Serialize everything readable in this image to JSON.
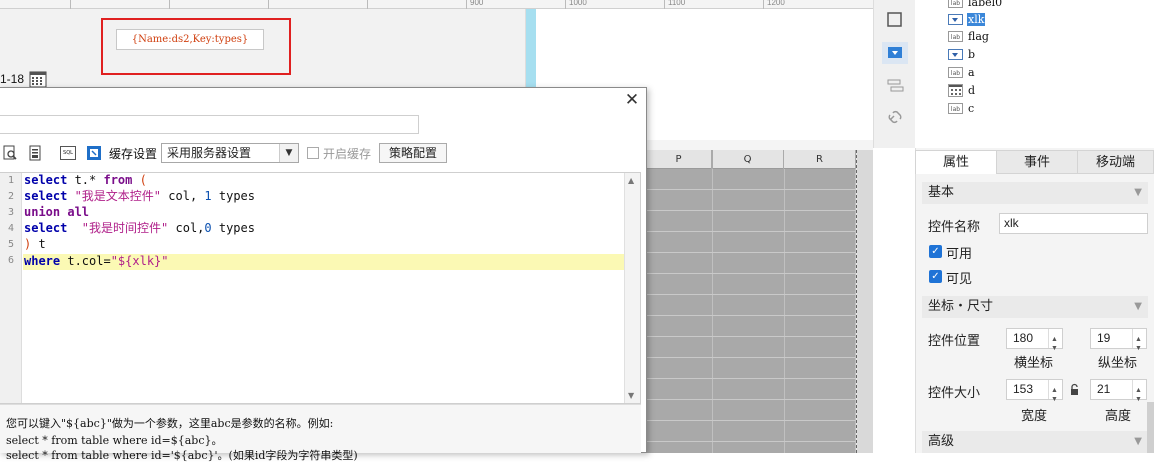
{
  "ruler": {
    "marks": [
      "900",
      "1000",
      "1100",
      "1200"
    ]
  },
  "canvas": {
    "param_label": "{Name:ds2,Key:types}",
    "date_text": "1-18"
  },
  "sheet": {
    "columns": [
      "P",
      "Q",
      "R"
    ]
  },
  "tree": {
    "items": [
      {
        "label": "label0",
        "icon": "label-widget-icon",
        "icon_text": "lab"
      },
      {
        "label": "xlk",
        "icon": "dropdown-widget-icon",
        "selected": true
      },
      {
        "label": "flag",
        "icon": "label-widget-icon",
        "icon_text": "lab"
      },
      {
        "label": "b",
        "icon": "dropdown-widget-icon"
      },
      {
        "label": "a",
        "icon": "label-widget-icon",
        "icon_text": "lab"
      },
      {
        "label": "d",
        "icon": "date-widget-icon"
      },
      {
        "label": "c",
        "icon": "label-widget-icon",
        "icon_text": "lab"
      }
    ]
  },
  "props": {
    "tabs": [
      "属性",
      "事件",
      "移动端"
    ],
    "section_basic": "基本",
    "name_label": "控件名称",
    "name_value": "xlk",
    "enabled_label": "可用",
    "visible_label": "可见",
    "section_pos": "坐标・尺寸",
    "pos_label": "控件位置",
    "pos_x": "180",
    "pos_y": "19",
    "x_caption": "横坐标",
    "y_caption": "纵坐标",
    "size_label": "控件大小",
    "width": "153",
    "height": "21",
    "w_caption": "宽度",
    "h_caption": "高度",
    "section_adv": "高级"
  },
  "dialog": {
    "close": "✕",
    "cache_label": "缓存设置",
    "cache_value": "采用服务器设置",
    "enable_cache": "开启缓存",
    "strategy_button": "策略配置",
    "toolbar_sql_icon_text": "SQL",
    "line_numbers": [
      "1",
      "2",
      "3",
      "4",
      "5",
      "6"
    ],
    "code": {
      "l1_kw": "select",
      "l1_mid": " t.* ",
      "l1_kw2": "from",
      "l1_paren": " (",
      "l2_kw": "select",
      "l2_str": " \"我是文本控件\"",
      "l2_mid": " col, ",
      "l2_num": "1",
      "l2_end": " types",
      "l3_kw": "union all",
      "l4_kw": "select",
      "l4_str": "  \"我是时间控件\"",
      "l4_mid": " col,",
      "l4_num": "0",
      "l4_end": " types",
      "l5_paren": ")",
      "l5_end": " t",
      "l6_kw": "where",
      "l6_mid": " t.col=",
      "l6_str": "\"${xlk}\""
    },
    "hint_lines": [
      "您可以键入\"${abc}\"做为一个参数，这里abc是参数的名称。例如:",
      "select * from table where id=${abc}。",
      "select * from table where id='${abc}'。(如果id字段为字符串类型)"
    ]
  },
  "colors": {
    "accent": "#1f73d6",
    "selection": "#3b87d9",
    "red_frame": "#e02020",
    "canvas_scrollbar": "#a6dff0",
    "line_highlight": "#fbf9b4"
  }
}
